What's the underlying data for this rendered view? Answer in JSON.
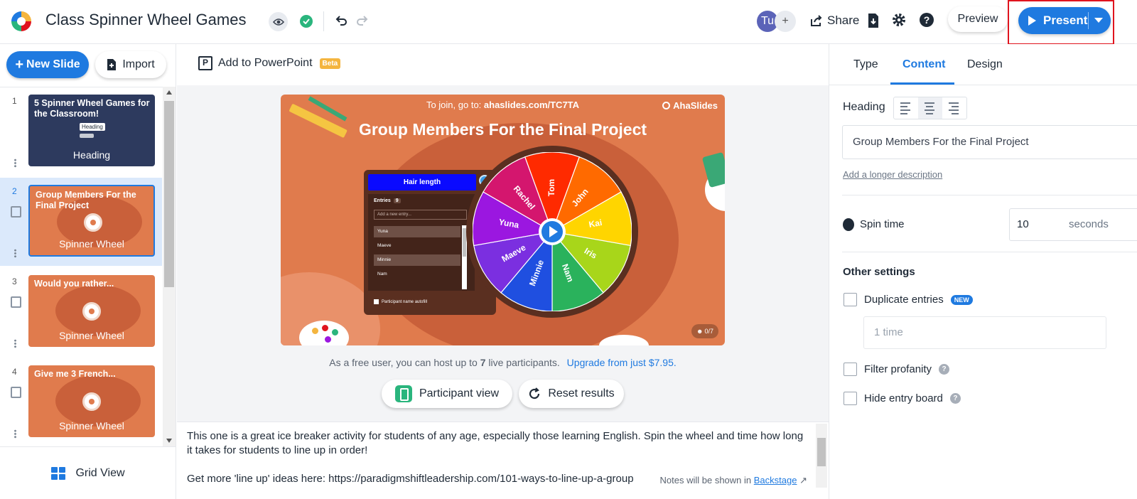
{
  "header": {
    "title": "Class Spinner Wheel Games",
    "avatar_initials": "Tu",
    "avatar_add": "+",
    "share_label": "Share",
    "help_label": "?",
    "preview_label": "Preview",
    "present_label": "Present"
  },
  "left": {
    "new_slide_label": "New Slide",
    "import_label": "Import",
    "grid_view_label": "Grid View",
    "slides": [
      {
        "num": "1",
        "title": "5 Spinner Wheel Games for the Classroom!",
        "label": "Heading",
        "badge": "Heading"
      },
      {
        "num": "2",
        "title": "Group Members For the Final Project",
        "label": "Spinner Wheel"
      },
      {
        "num": "3",
        "title": "Would you rather...",
        "label": "Spinner Wheel"
      },
      {
        "num": "4",
        "title": "Give me 3 French...",
        "label": "Spinner Wheel"
      }
    ]
  },
  "center": {
    "add_ppt_label": "Add to PowerPoint",
    "beta_label": "Beta",
    "slide": {
      "join_prefix": "To join, go to:",
      "join_url": "ahaslides.com/TC7TA",
      "brand": "AhaSlides",
      "title": "Group Members For the Final Project",
      "entries_box_title": "Hair length",
      "entries_label": "Entries",
      "entries_count": "9",
      "new_entry_placeholder": "Add a new entry...",
      "entry_items": [
        "Yuna",
        "Maeve",
        "Minnie",
        "Nam"
      ],
      "autofill_label": "Participant name autofill",
      "wheel_names": [
        "Tom",
        "John",
        "Kai",
        "Iris",
        "Nam",
        "Minnie",
        "Maeve",
        "Yuna",
        "Rachel"
      ],
      "participant_count": "0/7"
    },
    "free_note_prefix": "As a free user, you can host up to",
    "free_note_number": "7",
    "free_note_suffix": "live participants.",
    "upgrade_label": "Upgrade from just $7.95.",
    "participant_view_label": "Participant view",
    "reset_results_label": "Reset results",
    "notes_text": "This one is a great ice breaker activity for students of any age, especially those learning English. Spin the wheel and time how long it takes for students to line up in order!\n\nGet more 'line up' ideas here: https://paradigmshiftleadership.com/101-ways-to-line-up-a-group",
    "notes_hint_prefix": "Notes will be shown in",
    "notes_hint_link": "Backstage"
  },
  "right": {
    "tabs": [
      "Type",
      "Content",
      "Design"
    ],
    "active_tab": "Content",
    "heading_label": "Heading",
    "heading_value": "Group Members For the Final Project",
    "longer_description_label": "Add a longer description",
    "spin_time_label": "Spin time",
    "spin_time_value": "10",
    "spin_time_unit": "seconds",
    "other_settings_label": "Other settings",
    "duplicate_entries_label": "Duplicate entries",
    "new_badge": "NEW",
    "times_placeholder": "1 time",
    "filter_profanity_label": "Filter profanity",
    "hide_entry_board_label": "Hide entry board"
  },
  "colors": {
    "accent": "#1f7ae0",
    "slide_bg": "#e07b4d",
    "highlight_border": "#e0141e",
    "wheel_segments": [
      "#ff2a00",
      "#ff6a00",
      "#ffd500",
      "#a8d61a",
      "#2ab25c",
      "#1f4fe0",
      "#7b2fe0",
      "#9b17e0",
      "#d4166e"
    ]
  }
}
